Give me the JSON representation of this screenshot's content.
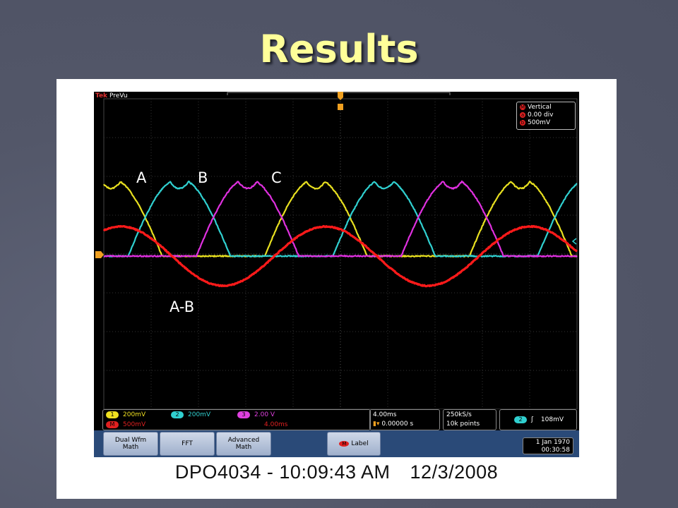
{
  "slide": {
    "title": "Results",
    "caption_model": "DPO4034 - 10:09:43 AM",
    "caption_date": "12/3/2008"
  },
  "scope": {
    "brand": "Tek",
    "status": "PreVu",
    "vertical_panel": {
      "title": "Vertical",
      "position": "0.00 div",
      "scale": "500mV"
    },
    "waveform_labels": {
      "a": "A",
      "b": "B",
      "c": "C",
      "a_minus_b": "A-B"
    },
    "channels": [
      {
        "num": "1",
        "scale": "200mV",
        "color": "#f0e020"
      },
      {
        "num": "2",
        "scale": "200mV",
        "color": "#30d0d0"
      },
      {
        "num": "3",
        "scale": "2.00 V",
        "color": "#e040e0"
      }
    ],
    "math": {
      "badge": "M",
      "scale": "500mV",
      "time": "4.00ms",
      "color": "#e02020"
    },
    "timebase": {
      "scale": "4.00ms",
      "delay": "0.00000 s"
    },
    "acquisition": {
      "rate": "250kS/s",
      "points": "10k points"
    },
    "trigger": {
      "channel": "2",
      "slope": "ʃ",
      "level": "108mV"
    },
    "buttons": {
      "dual_wfm_math": "Dual Wfm\nMath",
      "fft": "FFT",
      "advanced_math": "Advanced\nMath",
      "label": "Label"
    },
    "clock": {
      "date": "1 Jan  1970",
      "time": "00:30:58"
    },
    "trace_colors": {
      "a": "#e8e020",
      "b": "#30d0d0",
      "c": "#e030e0",
      "math": "#ff1a1a"
    }
  }
}
